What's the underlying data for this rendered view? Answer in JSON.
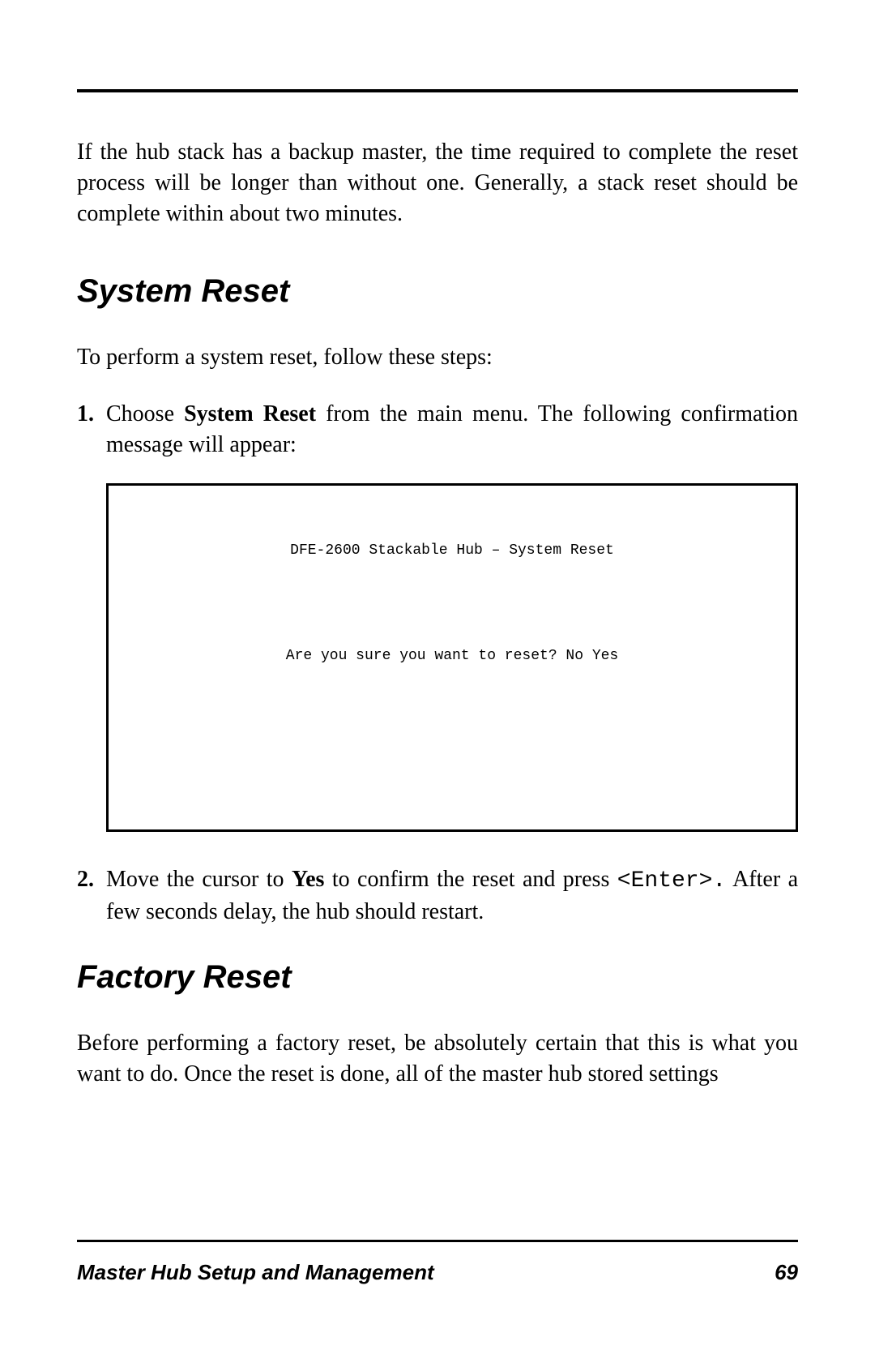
{
  "intro_text": "If the hub stack has a backup master, the time required to complete the reset process will be longer than without one.  Generally, a stack reset should be complete within about two minutes.",
  "section1": {
    "heading": "System Reset",
    "lead": "To perform a system reset, follow these steps:",
    "step1_num": "1.",
    "step1_prefix": "Choose ",
    "step1_bold": "System Reset",
    "step1_suffix": " from the main menu.  The following confirmation message will appear:",
    "screen_title": "DFE-2600 Stackable Hub – System Reset",
    "screen_prompt": "Are you sure you want to reset? No  Yes",
    "step2_num": "2.",
    "step2_prefix": "Move the cursor to ",
    "step2_bold": "Yes",
    "step2_mid": " to confirm the reset and press ",
    "step2_code": "<Enter>.",
    "step2_suffix": " After a few seconds delay, the hub should restart."
  },
  "section2": {
    "heading": "Factory Reset",
    "para": "Before performing a factory reset, be absolutely certain that this is what you want to do.  Once the reset is done, all of the master hub    stored settings"
  },
  "footer": {
    "left": "Master Hub Setup and Management",
    "right": "69"
  }
}
